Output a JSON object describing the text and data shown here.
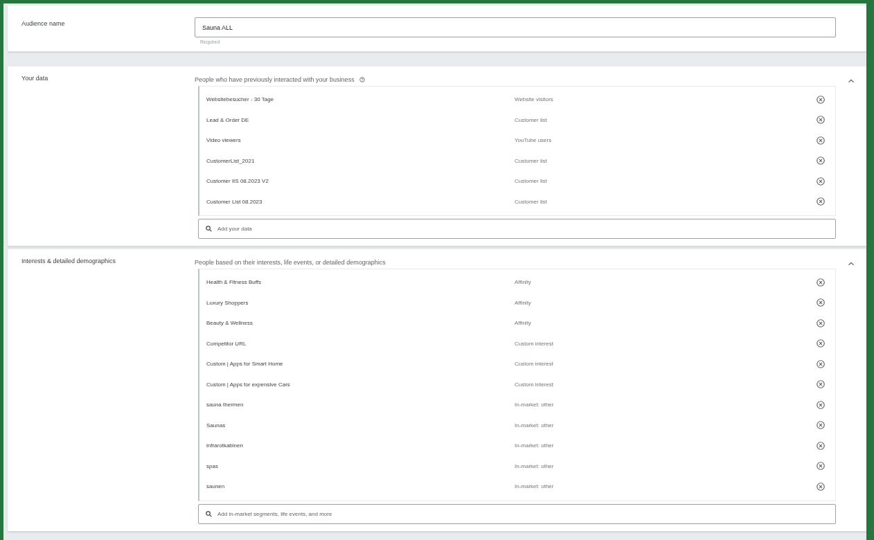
{
  "audience_name": {
    "label": "Audience name",
    "value": "Sauna ALL",
    "helper": "Required"
  },
  "sections": [
    {
      "label": "Your data",
      "description": "People who have previously interacted with your business",
      "help": true,
      "expanded": true,
      "items": [
        {
          "name": "Websitebesucher - 30 Tage",
          "type": "Website visitors"
        },
        {
          "name": "Lead & Order DE",
          "type": "Customer list"
        },
        {
          "name": "Video viewers",
          "type": "YouTube users"
        },
        {
          "name": "CustomerList_2021",
          "type": "Customer list"
        },
        {
          "name": "Customer IIS 08.2023 V2",
          "type": "Customer list"
        },
        {
          "name": "Customer List 08.2023",
          "type": "Customer list"
        }
      ],
      "search": {
        "placeholder": "Add your data"
      }
    },
    {
      "label": "Interests & detailed demographics",
      "description": "People based on their interests, life events, or detailed demographics",
      "help": false,
      "expanded": true,
      "items": [
        {
          "name": "Health & Fitness Buffs",
          "type": "Affinity"
        },
        {
          "name": "Luxury Shoppers",
          "type": "Affinity"
        },
        {
          "name": "Beauty & Wellness",
          "type": "Affinity"
        },
        {
          "name": "Competitor URL",
          "type": "Custom interest"
        },
        {
          "name": "Custom | Apps for Smart Home",
          "type": "Custom interest"
        },
        {
          "name": "Custom | Apps for expensive Cars",
          "type": "Custom interest"
        },
        {
          "name": "sauna thermen",
          "type": "In-market: other"
        },
        {
          "name": "Saunas",
          "type": "In-market: other"
        },
        {
          "name": "infrarotkabinen",
          "type": "In-market: other"
        },
        {
          "name": "spas",
          "type": "In-market: other"
        },
        {
          "name": "saunen",
          "type": "In-market: other"
        }
      ],
      "search": {
        "placeholder": "Add in-market segments, life events, and more"
      }
    }
  ]
}
